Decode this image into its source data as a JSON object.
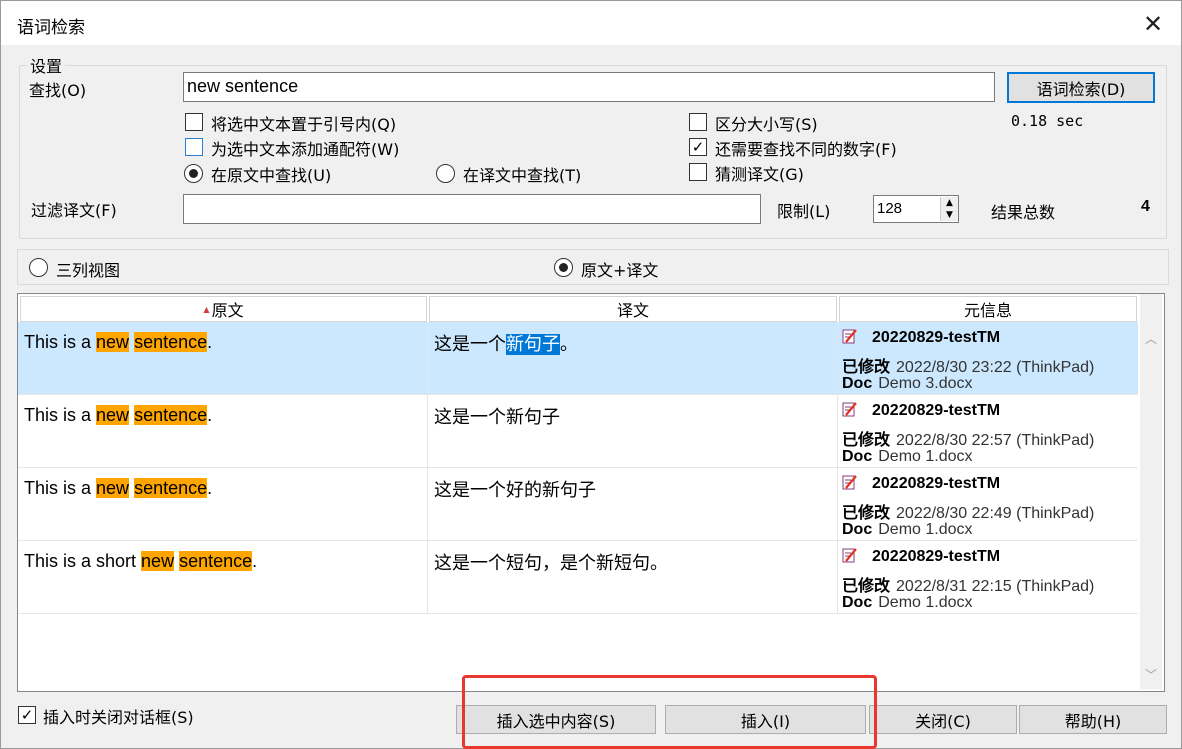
{
  "window": {
    "title": "语词检索",
    "close_glyph": "✕"
  },
  "settings": {
    "group_label": "设置",
    "find_label": "查找(O)",
    "find_value": "new sentence",
    "search_button": "语词检索(D)",
    "elapsed": "0.18 sec",
    "options": {
      "quote": {
        "label": "将选中文本置于引号内(Q)",
        "checked": false
      },
      "wildcard": {
        "label": "为选中文本添加通配符(W)",
        "checked": false
      },
      "search_source": {
        "label": "在原文中查找(U)",
        "selected": true
      },
      "search_target": {
        "label": "在译文中查找(T)",
        "selected": false
      },
      "case": {
        "label": "区分大小写(S)",
        "checked": false
      },
      "numbers": {
        "label": "还需要查找不同的数字(F)",
        "checked": true
      },
      "guess": {
        "label": "猜测译文(G)",
        "checked": false
      }
    },
    "filter_label": "过滤译文(F)",
    "filter_value": "",
    "limit_label": "限制(L)",
    "limit_value": "128",
    "total_label": "结果总数",
    "total_value": "4"
  },
  "view": {
    "three_col": {
      "label": "三列视图",
      "selected": false
    },
    "source_target": {
      "label": "原文+译文",
      "selected": true
    }
  },
  "grid": {
    "headers": {
      "source": "原文",
      "target": "译文",
      "meta": "元信息",
      "sort_glyph": "▲"
    },
    "rows": [
      {
        "selected": true,
        "src_pre": "This is a ",
        "src_hl1": "new",
        "src_mid": " ",
        "src_hl2": "sentence",
        "src_post": ".",
        "tgt_pre": "这是一个",
        "tgt_sel": "新句子",
        "tgt_post": "。",
        "tm": "20220829-testTM",
        "mod_label": "已修改",
        "mod_value": "2022/8/30 23:22 (ThinkPad)",
        "doc_label": "Doc",
        "doc_value": "Demo 3.docx"
      },
      {
        "selected": false,
        "src_pre": "This is a ",
        "src_hl1": "new",
        "src_mid": " ",
        "src_hl2": "sentence",
        "src_post": ".",
        "tgt_pre": "这是一个新句子",
        "tgt_sel": "",
        "tgt_post": "",
        "tm": "20220829-testTM",
        "mod_label": "已修改",
        "mod_value": "2022/8/30 22:57 (ThinkPad)",
        "doc_label": "Doc",
        "doc_value": "Demo 1.docx"
      },
      {
        "selected": false,
        "src_pre": "This is a ",
        "src_hl1": "new",
        "src_mid": " ",
        "src_hl2": "sentence",
        "src_post": ".",
        "tgt_pre": "这是一个好的新句子",
        "tgt_sel": "",
        "tgt_post": "",
        "tm": "20220829-testTM",
        "mod_label": "已修改",
        "mod_value": "2022/8/30 22:49 (ThinkPad)",
        "doc_label": "Doc",
        "doc_value": "Demo 1.docx"
      },
      {
        "selected": false,
        "src_pre": "This is a short ",
        "src_hl1": "new",
        "src_mid": " ",
        "src_hl2": "sentence",
        "src_post": ".",
        "tgt_pre": "这是一个短句，是个新短句。",
        "tgt_sel": "",
        "tgt_post": "",
        "tm": "20220829-testTM",
        "mod_label": "已修改",
        "mod_value": "2022/8/31 22:15 (ThinkPad)",
        "doc_label": "Doc",
        "doc_value": "Demo 1.docx"
      }
    ]
  },
  "footer": {
    "close_on_insert": {
      "label": "插入时关闭对话框(S)",
      "checked": true
    },
    "insert_selected": "插入选中内容(S)",
    "insert": "插入(I)",
    "close": "关闭(C)",
    "help": "帮助(H)"
  },
  "colors": {
    "highlight": "#ffa500",
    "selected_row": "#cce8ff",
    "selection": "#0078d7",
    "annotation": "#e8382d"
  }
}
